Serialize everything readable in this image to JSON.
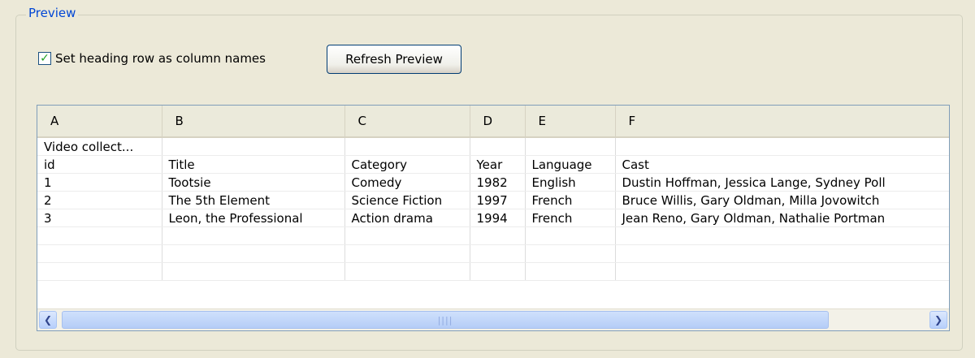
{
  "group": {
    "title": "Preview"
  },
  "options": {
    "heading_checkbox_checked": true,
    "heading_checkbox_label": "Set heading row as column names",
    "refresh_button_label": "Refresh Preview"
  },
  "table": {
    "columns": [
      "A",
      "B",
      "C",
      "D",
      "E",
      "F"
    ],
    "rows": [
      [
        "Video collect...",
        "",
        "",
        "",
        "",
        ""
      ],
      [
        "id",
        "Title",
        "Category",
        "Year",
        "Language",
        "Cast"
      ],
      [
        "1",
        "Tootsie",
        "Comedy",
        "1982",
        "English",
        "Dustin Hoffman, Jessica Lange, Sydney Poll"
      ],
      [
        "2",
        "The 5th Element",
        "Science Fiction",
        "1997",
        "French",
        "Bruce Willis, Gary Oldman, Milla Jovowitch"
      ],
      [
        "3",
        "Leon, the Professional",
        "Action drama",
        "1994",
        "French",
        "Jean Reno, Gary Oldman, Nathalie Portman"
      ],
      [
        "",
        "",
        "",
        "",
        "",
        ""
      ],
      [
        "",
        "",
        "",
        "",
        "",
        ""
      ],
      [
        "",
        "",
        "",
        "",
        "",
        ""
      ]
    ]
  },
  "icons": {
    "check": "✓",
    "scroll_left": "❮",
    "scroll_right": "❯",
    "grip": "||||"
  }
}
